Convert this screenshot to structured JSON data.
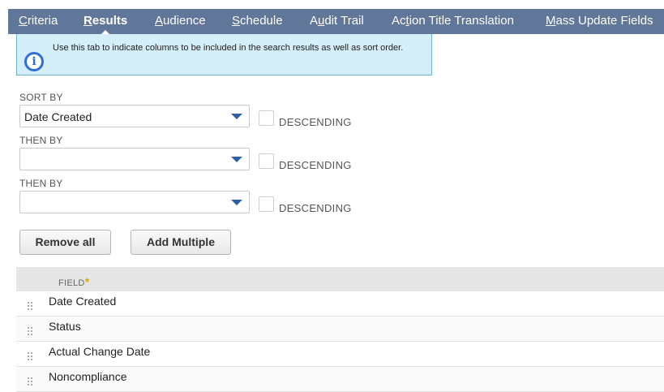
{
  "tabs": [
    {
      "label": "Criteria",
      "key": "C",
      "rest": "riteria",
      "active": false
    },
    {
      "label": "Results",
      "key": "R",
      "rest": "esults",
      "active": true
    },
    {
      "label": "Audience",
      "key": "A",
      "rest": "udience",
      "active": false
    },
    {
      "label": "Schedule",
      "key": "S",
      "rest": "chedule",
      "active": false
    },
    {
      "label": "Audit Trail",
      "pre": "A",
      "key": "u",
      "rest": "dit Trail",
      "active": false
    },
    {
      "label": "Action Title Translation",
      "pre": "Ac",
      "key": "t",
      "rest": "ion Title Translation",
      "active": false
    },
    {
      "label": "Mass Update Fields",
      "key": "M",
      "rest": "ass Update Fields",
      "active": false
    }
  ],
  "info": {
    "icon": "info-icon",
    "message": "Use this tab to indicate columns to be included in the search results as well as sort order."
  },
  "sort": {
    "sort_by_label": "SORT BY",
    "sort_by_value": "Date Created",
    "then_by_1_label": "THEN BY",
    "then_by_1_value": "",
    "then_by_2_label": "THEN BY",
    "then_by_2_value": "",
    "descending_label": "DESCENDING"
  },
  "buttons": {
    "remove_all": "Remove all",
    "add_multiple": "Add Multiple"
  },
  "grid": {
    "field_header": "FIELD",
    "required_mark": "*",
    "rows": [
      "Date Created",
      "Status",
      "Actual Change Date",
      "Noncompliance"
    ]
  },
  "colors": {
    "tabbar": "#607799",
    "info_bg": "#d4eefa",
    "info_icon": "#2f6fd6",
    "dropdown_arrow": "#2d5fa8",
    "required": "#e0a800"
  }
}
